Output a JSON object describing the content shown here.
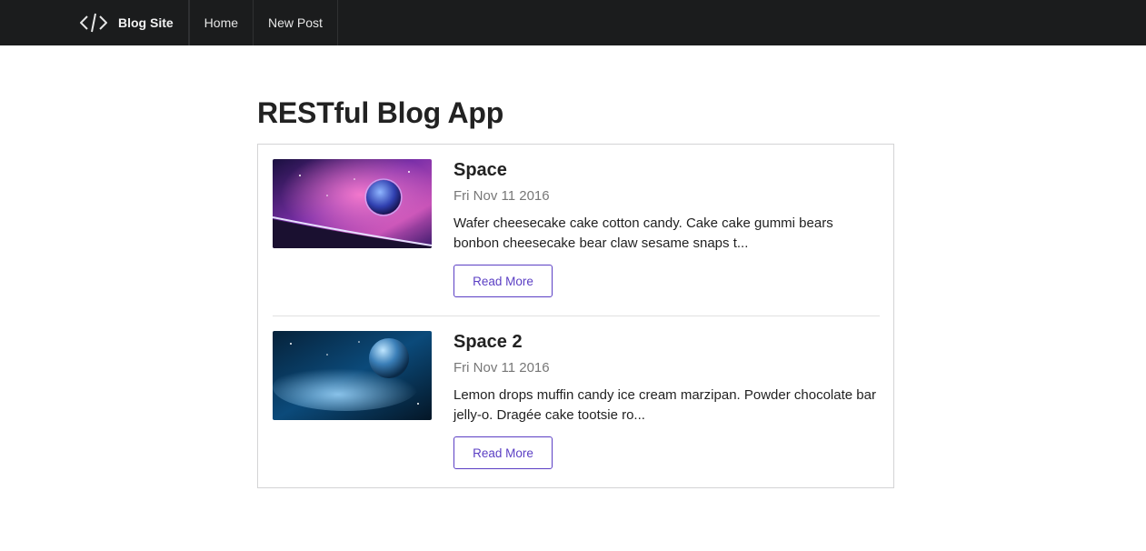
{
  "navbar": {
    "brand_icon": "code-icon",
    "brand_label": "Blog Site",
    "links": [
      {
        "label": "Home"
      },
      {
        "label": "New Post"
      }
    ]
  },
  "page": {
    "title": "RESTful Blog App"
  },
  "posts": [
    {
      "title": "Space",
      "date": "Fri Nov 11 2016",
      "excerpt": "Wafer cheesecake cake cotton candy. Cake cake gummi bears bonbon cheesecake bear claw sesame snaps t...",
      "button_label": "Read More",
      "image": "space-planet-nebula-image"
    },
    {
      "title": "Space 2",
      "date": "Fri Nov 11 2016",
      "excerpt": "Lemon drops muffin candy ice cream marzipan. Powder chocolate bar jelly-o. Dragée cake tootsie ro...",
      "button_label": "Read More",
      "image": "space-blue-planet-image"
    }
  ],
  "colors": {
    "navbar_bg": "#1b1c1d",
    "accent": "#5b3fc4",
    "border": "#d4d4d5"
  }
}
